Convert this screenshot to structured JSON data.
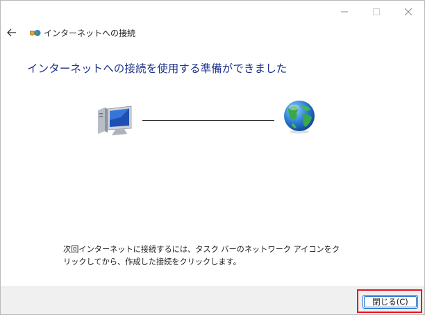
{
  "window": {
    "title": "インターネットへの接続",
    "controls": {
      "minimize_icon": "minimize-icon",
      "maximize_icon": "maximize-icon",
      "close_icon": "close-icon"
    }
  },
  "nav": {
    "back_icon": "arrow-left-icon",
    "app_icon": "network-connection-icon",
    "title": "インターネットへの接続"
  },
  "main": {
    "heading": "インターネットへの接続を使用する準備ができました",
    "graphic": {
      "left_icon": "computer-icon",
      "right_icon": "globe-icon"
    },
    "message": "次回インターネットに接続するには、タスク バーのネットワーク アイコンをクリックしてから、作成した接続をクリックします。"
  },
  "footer": {
    "close_label": "閉じる(C)"
  },
  "colors": {
    "heading": "#1e3287",
    "highlight_box": "#e8111c",
    "button_border": "#1f6fd1",
    "footer_bg": "#f0f0f0"
  }
}
